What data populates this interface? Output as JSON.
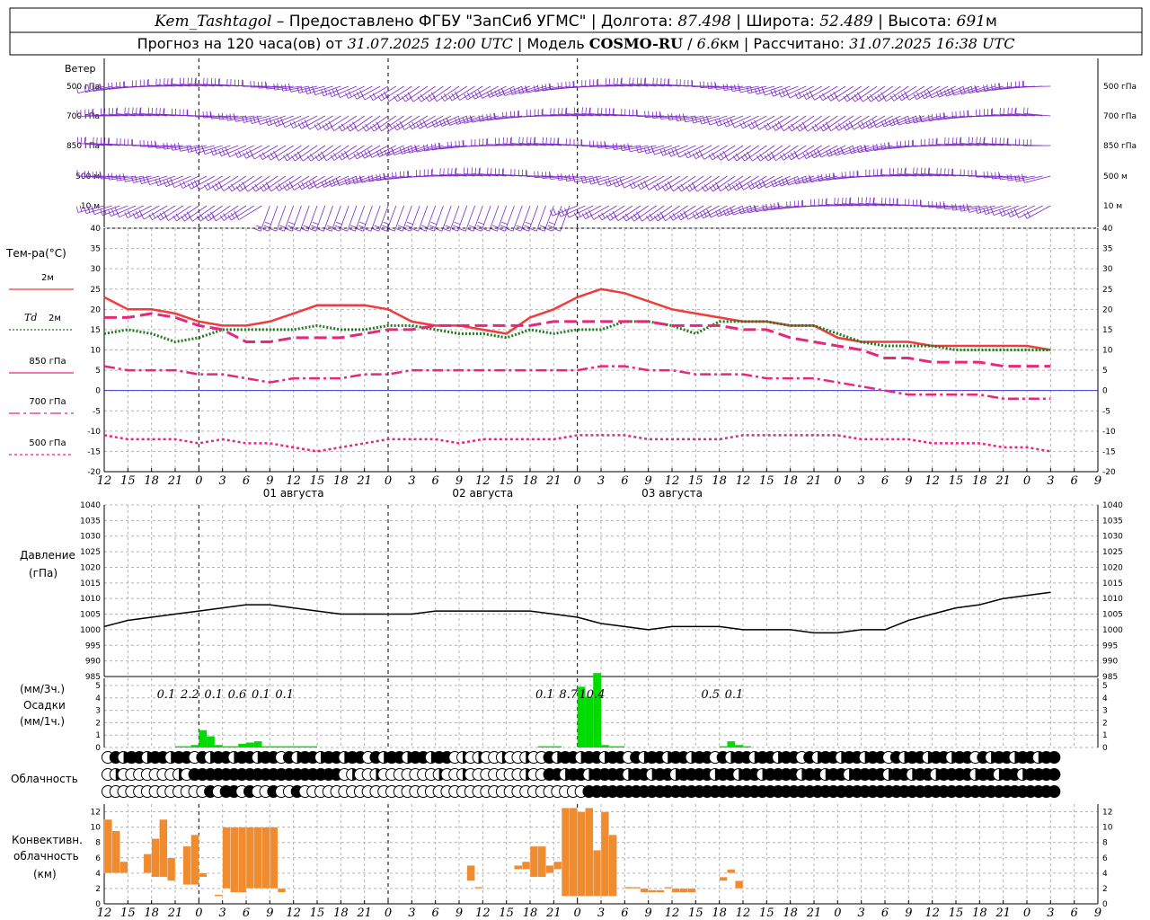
{
  "header": {
    "line1": [
      {
        "t": "Kem_Tashtagol",
        "s": "i"
      },
      {
        "t": " – Предоставлено ФГБУ \"ЗапСиб УГМС\" | Долгота: ",
        "s": "n"
      },
      {
        "t": "87.498",
        "s": "i"
      },
      {
        "t": " | Широта: ",
        "s": "n"
      },
      {
        "t": "52.489",
        "s": "i"
      },
      {
        "t": " | Высота: ",
        "s": "n"
      },
      {
        "t": "691",
        "s": "i"
      },
      {
        "t": "м",
        "s": "n"
      }
    ],
    "line2": [
      {
        "t": "Прогноз на 120 часа(ов) от ",
        "s": "n"
      },
      {
        "t": "31.07.2025 12:00 UTC",
        "s": "i"
      },
      {
        "t": "  | Модель ",
        "s": "n"
      },
      {
        "t": "COSMO-RU",
        "s": "b"
      },
      {
        "t": " / ",
        "s": "n"
      },
      {
        "t": "6.6",
        "s": "i"
      },
      {
        "t": "км | Рассчитано: ",
        "s": "n"
      },
      {
        "t": "31.07.2025 16:38 UTC",
        "s": "i"
      }
    ]
  },
  "time_axis": {
    "tick_labels": [
      "12",
      "15",
      "18",
      "21",
      "0",
      "3",
      "6",
      "9",
      "12",
      "15",
      "18",
      "21",
      "0",
      "3",
      "6",
      "9",
      "12",
      "15",
      "18",
      "21",
      "0",
      "3",
      "6",
      "9",
      "12",
      "15",
      "18"
    ],
    "dates": [
      {
        "label": "01 августа",
        "at_hour": 24
      },
      {
        "label": "02 августа",
        "at_hour": 48
      },
      {
        "label": "03 августа",
        "at_hour": 72
      }
    ],
    "day_separators_hours": [
      12,
      36,
      60
    ]
  },
  "wind_panel": {
    "title": "Ветер",
    "levels": [
      "500 гПа",
      "700 гПа",
      "850 гПа",
      "500 м",
      "10  м"
    ],
    "color": "#7b28c8"
  },
  "temperature_panel": {
    "title": "Тем-ра(°С)",
    "legend": [
      {
        "label": "2м",
        "color": "#f03c3c",
        "dash": "solid"
      },
      {
        "label": "Td  2м",
        "color": "#1e7a1e",
        "dash": "dot"
      },
      {
        "label": "850 гПа",
        "color": "#e6287a",
        "dash": "long"
      },
      {
        "label": "700 гПа",
        "color": "#e6287a",
        "dash": "dashdot"
      },
      {
        "label": "500 гПа",
        "color": "#e6287a",
        "dash": "fine"
      }
    ],
    "ylim": [
      -20,
      40
    ],
    "yticks": [
      -20,
      -15,
      -10,
      -5,
      0,
      5,
      10,
      15,
      20,
      25,
      30,
      35,
      40
    ]
  },
  "pressure_panel": {
    "title": "Давление",
    "unit": "(гПа)",
    "ylim": [
      985,
      1040
    ],
    "yticks": [
      985,
      990,
      995,
      1000,
      1005,
      1010,
      1015,
      1020,
      1025,
      1030,
      1035,
      1040
    ]
  },
  "precip_panel": {
    "unit_top": "(мм/3ч.)",
    "title": "Осадки",
    "unit_bottom": "(мм/1ч.)",
    "ylim": [
      0,
      5
    ],
    "yticks": [
      0,
      1,
      2,
      3,
      4,
      5
    ],
    "color": "#00dc00",
    "totals": [
      {
        "hour": 9,
        "label": "0.1"
      },
      {
        "hour": 12,
        "label": "2.2"
      },
      {
        "hour": 15,
        "label": "0.1"
      },
      {
        "hour": 18,
        "label": "0.6"
      },
      {
        "hour": 21,
        "label": "0.1"
      },
      {
        "hour": 24,
        "label": "0.1"
      },
      {
        "hour": 57,
        "label": "0.1"
      },
      {
        "hour": 60,
        "label": "8.7"
      },
      {
        "hour": 63,
        "label": "10.4"
      },
      {
        "hour": 78,
        "label": "0.5"
      },
      {
        "hour": 81,
        "label": "0.1"
      }
    ]
  },
  "cloud_panel": {
    "title": "Облачность"
  },
  "convective_panel": {
    "title_lines": [
      "Конвективн.",
      "облачность",
      "(км)"
    ],
    "ylim": [
      0,
      13
    ],
    "yticks": [
      0,
      2,
      4,
      6,
      8,
      10,
      12
    ],
    "color": "#f08c30"
  },
  "chart_data": [
    {
      "type": "line",
      "panel": "temperature",
      "x_hours": [
        0,
        3,
        6,
        9,
        12,
        15,
        18,
        21,
        24,
        27,
        30,
        33,
        36,
        39,
        42,
        45,
        48,
        51,
        54,
        57,
        60,
        63,
        66,
        69,
        72,
        75,
        78,
        81,
        84,
        87,
        90,
        93,
        96,
        99,
        102,
        105,
        108,
        111,
        114,
        117,
        120
      ],
      "series": [
        {
          "name": "2м",
          "values": [
            23,
            20,
            20,
            19,
            17,
            16,
            16,
            17,
            19,
            21,
            21,
            21,
            20,
            17,
            16,
            16,
            15,
            14,
            18,
            20,
            23,
            25,
            24,
            22,
            20,
            19,
            18,
            17,
            17,
            16,
            16,
            13,
            12,
            12,
            12,
            11,
            11,
            11,
            11,
            11,
            10
          ]
        },
        {
          "name": "Td  2м",
          "values": [
            14,
            15,
            14,
            12,
            13,
            15,
            15,
            15,
            15,
            16,
            15,
            15,
            16,
            16,
            15,
            14,
            14,
            13,
            15,
            14,
            15,
            15,
            17,
            17,
            16,
            14,
            17,
            17,
            17,
            16,
            16,
            14,
            12,
            11,
            11,
            11,
            10,
            10,
            10,
            10,
            10
          ]
        },
        {
          "name": "850 гПа",
          "values": [
            18,
            18,
            19,
            18,
            16,
            15,
            12,
            12,
            13,
            13,
            13,
            14,
            15,
            15,
            16,
            16,
            16,
            16,
            16,
            17,
            17,
            17,
            17,
            17,
            16,
            16,
            16,
            15,
            15,
            13,
            12,
            11,
            10,
            8,
            8,
            7,
            7,
            7,
            6,
            6,
            6
          ]
        },
        {
          "name": "700 гПа",
          "values": [
            6,
            5,
            5,
            5,
            4,
            4,
            3,
            2,
            3,
            3,
            3,
            4,
            4,
            5,
            5,
            5,
            5,
            5,
            5,
            5,
            5,
            6,
            6,
            5,
            5,
            4,
            4,
            4,
            3,
            3,
            3,
            2,
            1,
            0,
            -1,
            -1,
            -1,
            -1,
            -2,
            -2,
            -2
          ]
        },
        {
          "name": "500 гПа",
          "values": [
            -11,
            -12,
            -12,
            -12,
            -13,
            -12,
            -13,
            -13,
            -14,
            -15,
            -14,
            -13,
            -12,
            -12,
            -12,
            -13,
            -12,
            -12,
            -12,
            -12,
            -11,
            -11,
            -11,
            -12,
            -12,
            -12,
            -12,
            -11,
            -11,
            -11,
            -11,
            -11,
            -12,
            -12,
            -12,
            -13,
            -13,
            -13,
            -14,
            -14,
            -15
          ]
        }
      ]
    },
    {
      "type": "line",
      "panel": "pressure",
      "x_hours": [
        0,
        3,
        6,
        9,
        12,
        15,
        18,
        21,
        24,
        27,
        30,
        33,
        36,
        39,
        42,
        45,
        48,
        51,
        54,
        57,
        60,
        63,
        66,
        69,
        72,
        75,
        78,
        81,
        84,
        87,
        90,
        93,
        96,
        99,
        102,
        105,
        108,
        111,
        114,
        117,
        120
      ],
      "series": [
        {
          "name": "Давление",
          "values": [
            1001,
            1003,
            1004,
            1005,
            1006,
            1007,
            1008,
            1008,
            1007,
            1006,
            1005,
            1005,
            1005,
            1005,
            1006,
            1006,
            1006,
            1006,
            1006,
            1005,
            1004,
            1002,
            1001,
            1000,
            1001,
            1001,
            1001,
            1000,
            1000,
            1000,
            999,
            999,
            1000,
            1000,
            1003,
            1005,
            1007,
            1008,
            1010,
            1011,
            1012
          ]
        }
      ]
    },
    {
      "type": "bar",
      "panel": "precipitation",
      "x_hours": [
        9,
        10,
        11,
        12,
        13,
        14,
        15,
        16,
        17,
        18,
        19,
        20,
        21,
        22,
        23,
        24,
        25,
        26,
        55,
        56,
        57,
        58,
        59,
        60,
        61,
        62,
        63,
        64,
        65,
        66,
        67,
        68,
        69,
        70,
        71,
        72,
        73,
        74,
        75,
        76,
        77,
        78,
        79,
        80,
        81
      ],
      "values": [
        0.1,
        0.1,
        0.2,
        1.4,
        0.9,
        0.2,
        0.1,
        0.1,
        0.3,
        0.4,
        0.5,
        0.1,
        0.1,
        0.1,
        0.1,
        0.1,
        0.1,
        0.1,
        0.1,
        0.1,
        0.1,
        0,
        0,
        4.9,
        4.1,
        6.0,
        0.2,
        0.1,
        0.1,
        0,
        0,
        0,
        0,
        0,
        0,
        0,
        0,
        0,
        0,
        0,
        0,
        0.1,
        0.5,
        0.2,
        0.1
      ]
    },
    {
      "type": "bar",
      "panel": "convective_cloud",
      "bars": [
        {
          "h": 0,
          "bottom": 4,
          "top": 11
        },
        {
          "h": 1,
          "bottom": 4,
          "top": 9.5
        },
        {
          "h": 2,
          "bottom": 4,
          "top": 5.5
        },
        {
          "h": 5,
          "bottom": 4,
          "top": 6.5
        },
        {
          "h": 6,
          "bottom": 3.5,
          "top": 8.5
        },
        {
          "h": 7,
          "bottom": 3.5,
          "top": 11
        },
        {
          "h": 8,
          "bottom": 3,
          "top": 6
        },
        {
          "h": 10,
          "bottom": 2.5,
          "top": 7.5
        },
        {
          "h": 11,
          "bottom": 2.5,
          "top": 9
        },
        {
          "h": 12,
          "bottom": 3.5,
          "top": 4
        },
        {
          "h": 14,
          "bottom": 1,
          "top": 1.2
        },
        {
          "h": 15,
          "bottom": 2,
          "top": 10
        },
        {
          "h": 16,
          "bottom": 1.5,
          "top": 10
        },
        {
          "h": 17,
          "bottom": 1.5,
          "top": 10
        },
        {
          "h": 18,
          "bottom": 2,
          "top": 10
        },
        {
          "h": 19,
          "bottom": 2,
          "top": 10
        },
        {
          "h": 20,
          "bottom": 2,
          "top": 10
        },
        {
          "h": 21,
          "bottom": 2,
          "top": 10
        },
        {
          "h": 22,
          "bottom": 1.5,
          "top": 2
        },
        {
          "h": 46,
          "bottom": 3,
          "top": 5
        },
        {
          "h": 47,
          "bottom": 2,
          "top": 2.2
        },
        {
          "h": 52,
          "bottom": 4.5,
          "top": 5
        },
        {
          "h": 53,
          "bottom": 4.5,
          "top": 5.5
        },
        {
          "h": 54,
          "bottom": 3.5,
          "top": 7.5
        },
        {
          "h": 55,
          "bottom": 3.5,
          "top": 7.5
        },
        {
          "h": 56,
          "bottom": 4,
          "top": 5
        },
        {
          "h": 57,
          "bottom": 4.5,
          "top": 5.5
        },
        {
          "h": 58,
          "bottom": 1,
          "top": 12.5
        },
        {
          "h": 59,
          "bottom": 1,
          "top": 12.5
        },
        {
          "h": 60,
          "bottom": 1,
          "top": 12
        },
        {
          "h": 61,
          "bottom": 1,
          "top": 12.5
        },
        {
          "h": 62,
          "bottom": 1,
          "top": 7
        },
        {
          "h": 63,
          "bottom": 1,
          "top": 12
        },
        {
          "h": 64,
          "bottom": 1,
          "top": 9
        },
        {
          "h": 66,
          "bottom": 2,
          "top": 2.2
        },
        {
          "h": 67,
          "bottom": 2,
          "top": 2.2
        },
        {
          "h": 68,
          "bottom": 1.5,
          "top": 2
        },
        {
          "h": 69,
          "bottom": 1.5,
          "top": 1.8
        },
        {
          "h": 70,
          "bottom": 1.5,
          "top": 1.8
        },
        {
          "h": 71,
          "bottom": 2,
          "top": 2.2
        },
        {
          "h": 72,
          "bottom": 1.5,
          "top": 2
        },
        {
          "h": 73,
          "bottom": 1.5,
          "top": 2
        },
        {
          "h": 74,
          "bottom": 1.5,
          "top": 2
        },
        {
          "h": 78,
          "bottom": 3,
          "top": 3.5
        },
        {
          "h": 79,
          "bottom": 4,
          "top": 4.5
        },
        {
          "h": 80,
          "bottom": 2,
          "top": 3
        }
      ]
    }
  ]
}
